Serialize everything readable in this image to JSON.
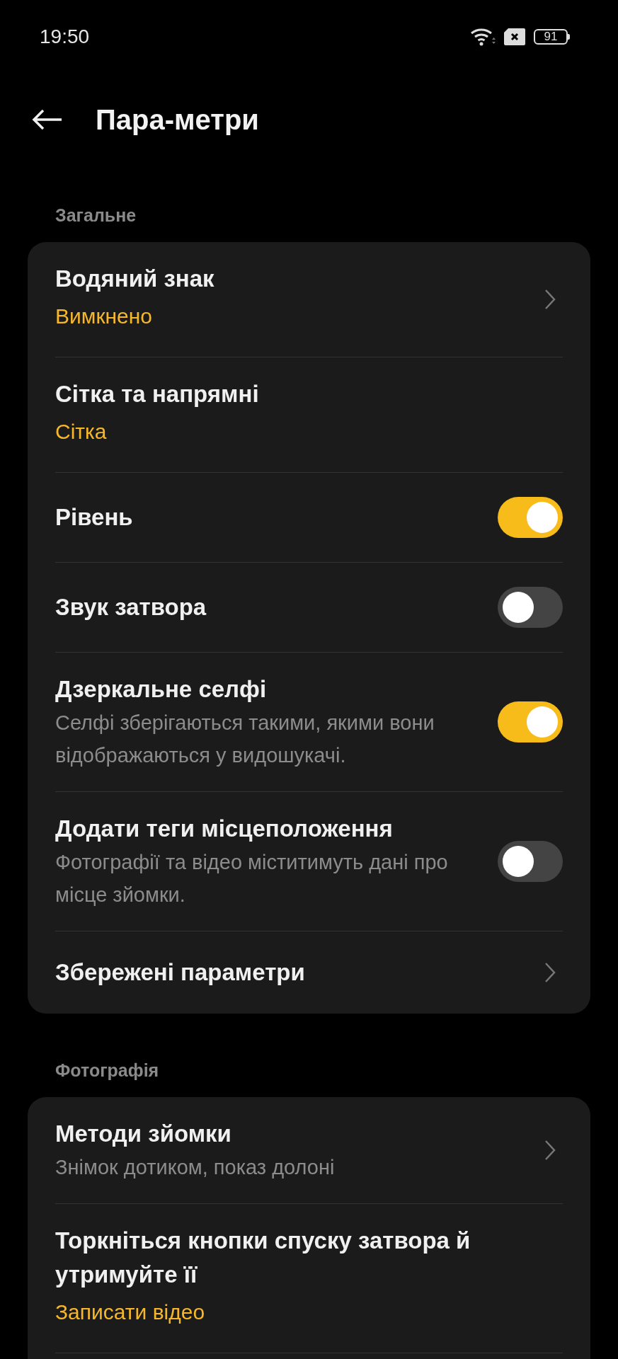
{
  "status_bar": {
    "time": "19:50",
    "battery": "91"
  },
  "header": {
    "title": "Пара-метри"
  },
  "sections": [
    {
      "label": "Загальне",
      "rows": [
        {
          "kind": "link",
          "title": "Водяний знак",
          "value": "Вимкнено"
        },
        {
          "kind": "plain",
          "title": "Сітка та напрямні",
          "value": "Сітка"
        },
        {
          "kind": "toggle",
          "title": "Рівень",
          "on": true
        },
        {
          "kind": "toggle",
          "title": "Звук затвора",
          "on": false
        },
        {
          "kind": "toggle",
          "title": "Дзеркальне селфі",
          "description": "Селфі зберігаються такими, якими вони відображаються у видошукачі.",
          "on": true
        },
        {
          "kind": "toggle",
          "title": "Додати теги місцеположення",
          "description": "Фотографії та відео міститимуть дані про місце зйомки.",
          "on": false
        },
        {
          "kind": "link",
          "title": "Збережені параметри"
        }
      ]
    },
    {
      "label": "Фотографія",
      "rows": [
        {
          "kind": "link",
          "title": "Методи зйомки",
          "description": "Знімок дотиком, показ долоні"
        },
        {
          "kind": "plain",
          "title": "Торкніться кнопки спуску затвора й утримуйте її",
          "value": "Записати відео"
        }
      ]
    }
  ]
}
